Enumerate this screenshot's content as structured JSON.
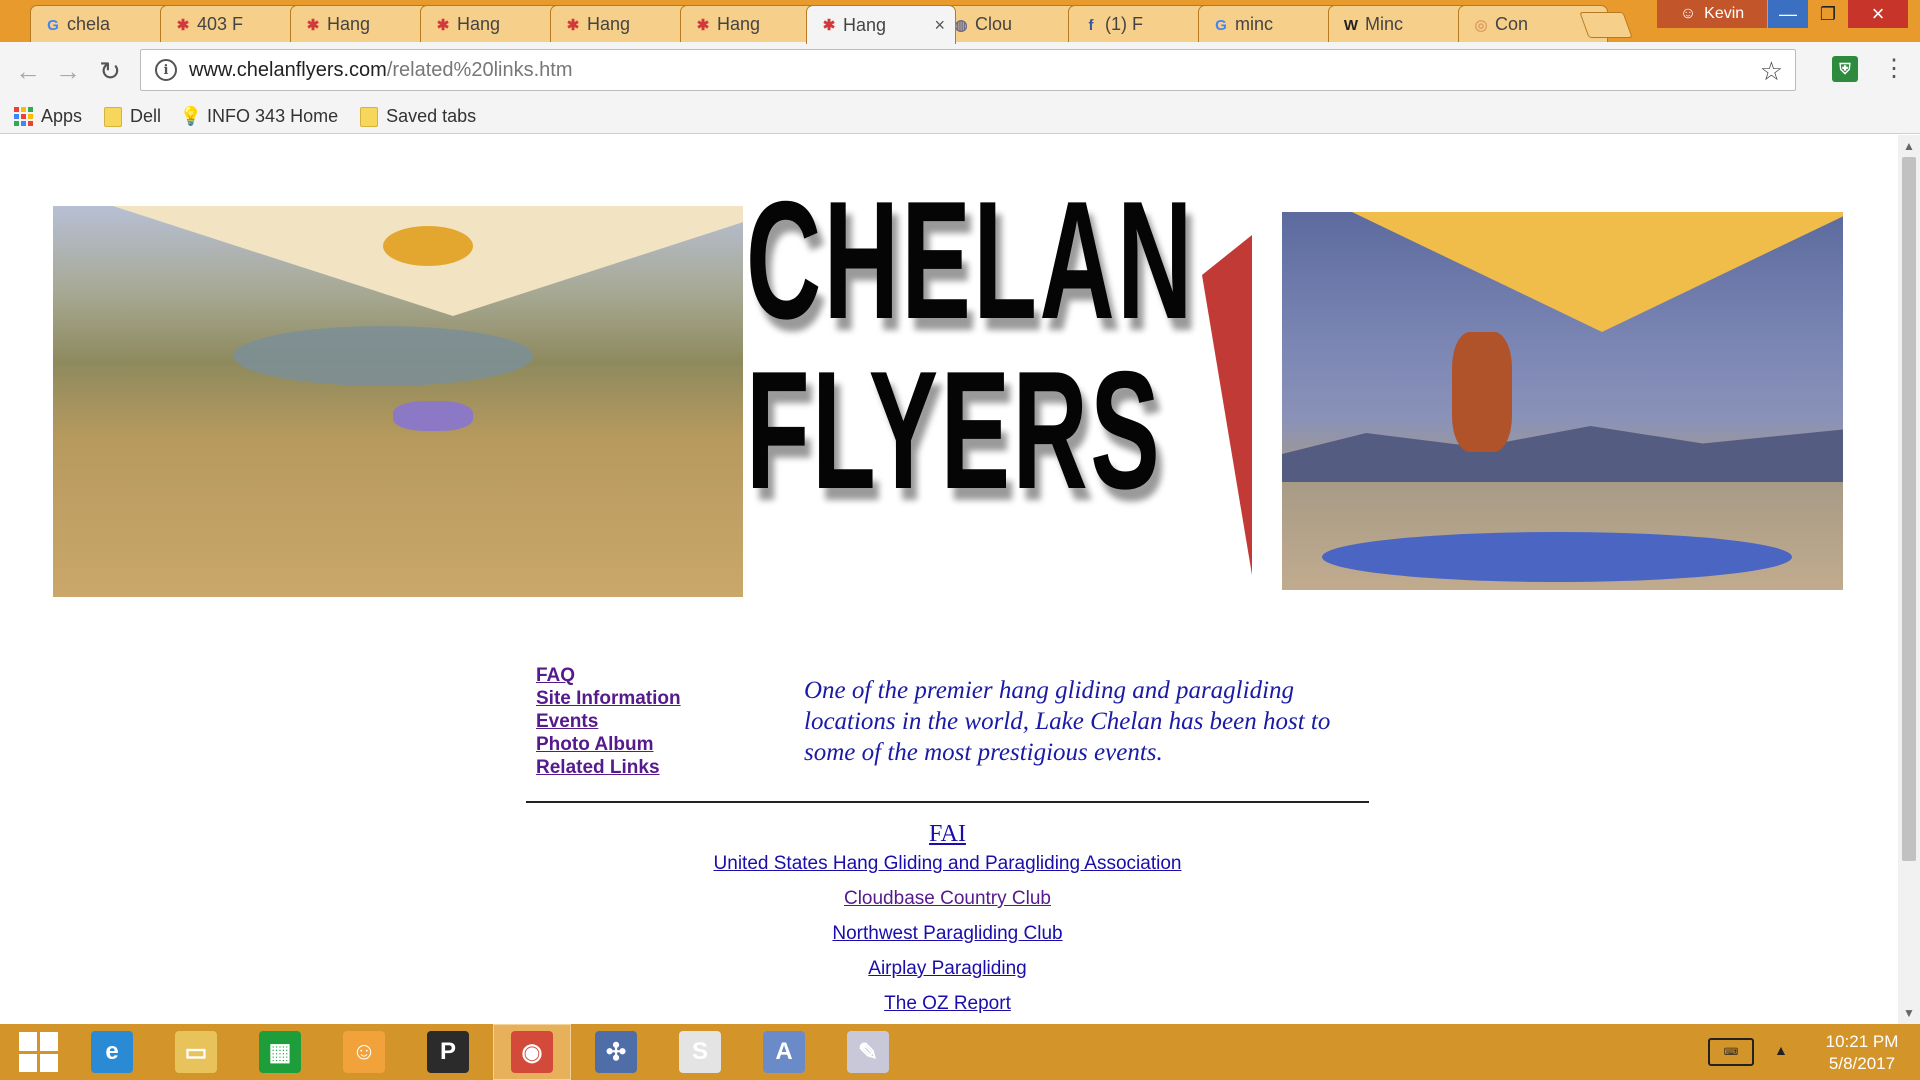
{
  "browser": {
    "tabs": [
      {
        "title": "chela",
        "icon": "google-icon",
        "icon_color": "#4285f4",
        "active": false
      },
      {
        "title": "403 F",
        "icon": "chelan-flyers-icon",
        "icon_color": "#d13a3a",
        "active": false
      },
      {
        "title": "Hang",
        "icon": "chelan-flyers-icon",
        "icon_color": "#d13a3a",
        "active": false
      },
      {
        "title": "Hang",
        "icon": "chelan-flyers-icon",
        "icon_color": "#d13a3a",
        "active": false
      },
      {
        "title": "Hang",
        "icon": "chelan-flyers-icon",
        "icon_color": "#d13a3a",
        "active": false
      },
      {
        "title": "Hang",
        "icon": "chelan-flyers-icon",
        "icon_color": "#d13a3a",
        "active": false
      },
      {
        "title": "Hang",
        "icon": "chelan-flyers-icon",
        "icon_color": "#d13a3a",
        "active": true
      },
      {
        "title": "Clou",
        "icon": "globe-icon",
        "icon_color": "#6a6a8a",
        "active": false
      },
      {
        "title": "(1) F",
        "icon": "facebook-icon",
        "icon_color": "#3b5998",
        "active": false
      },
      {
        "title": "minc",
        "icon": "google-icon",
        "icon_color": "#4285f4",
        "active": false
      },
      {
        "title": "Minc",
        "icon": "wikipedia-icon",
        "icon_color": "#222222",
        "active": false
      },
      {
        "title": "Con",
        "icon": "planet-icon",
        "icon_color": "#e0a060",
        "active": false
      }
    ],
    "close_glyph": "×",
    "profile_name": "Kevin",
    "window_buttons": {
      "minimize": "—",
      "maximize": "❐",
      "close": "×"
    },
    "nav": {
      "back": "←",
      "forward": "→",
      "reload": "↻"
    },
    "url_host": "www.chelanflyers.com",
    "url_path": "/related%20links.htm",
    "bookmarks": [
      {
        "label": "Apps",
        "icon": "apps-grid-icon"
      },
      {
        "label": "Dell",
        "icon": "folder-icon"
      },
      {
        "label": "INFO 343 Home",
        "icon": "bulb-icon"
      },
      {
        "label": "Saved tabs",
        "icon": "folder-icon"
      }
    ]
  },
  "page": {
    "logo_line1": "CHELAN",
    "logo_line2": "FLYERS",
    "nav_links": [
      "FAQ",
      "Site Information",
      "Events",
      "Photo Album",
      "Related Links"
    ],
    "tagline": "One of the premier hang gliding and paragliding locations in the world, Lake Chelan has been host to some of the most prestigious events.",
    "related_links": {
      "fai": "FAI",
      "items": [
        "United States Hang Gliding and Paragliding Association",
        "Cloudbase Country Club",
        "Northwest Paragliding Club",
        "Airplay Paragliding"
      ],
      "oz_report": "The OZ Report"
    }
  },
  "taskbar": {
    "apps": [
      {
        "name": "internet-explorer-icon",
        "glyph": "e",
        "color": "#2a8ad4"
      },
      {
        "name": "file-explorer-icon",
        "glyph": "▭",
        "color": "#e8c25a"
      },
      {
        "name": "store-icon",
        "glyph": "▦",
        "color": "#1e9e3a"
      },
      {
        "name": "scratch-cat-icon",
        "glyph": "☺",
        "color": "#f2a23a"
      },
      {
        "name": "p-app-icon",
        "glyph": "P",
        "color": "#2b2b2b"
      },
      {
        "name": "chrome-icon",
        "glyph": "◉",
        "color": "#d44a3a"
      },
      {
        "name": "snipping-icon",
        "glyph": "✣",
        "color": "#4f6ea8"
      },
      {
        "name": "slack-icon",
        "glyph": "S",
        "color": "#e4e4e4"
      },
      {
        "name": "reader-icon",
        "glyph": "A",
        "color": "#6a8ac8"
      },
      {
        "name": "paint-icon",
        "glyph": "✎",
        "color": "#c8c8d8"
      }
    ],
    "time": "10:21 PM",
    "date": "5/8/2017"
  }
}
